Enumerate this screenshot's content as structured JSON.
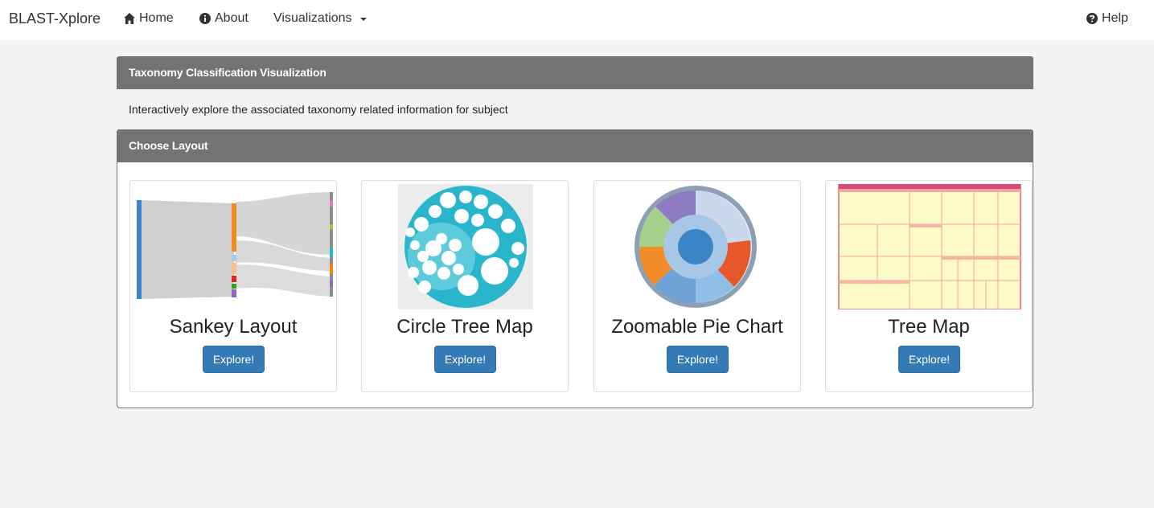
{
  "nav": {
    "brand": "BLAST-Xplore",
    "home": "Home",
    "about": "About",
    "visualizations": "Visualizations",
    "help": "Help"
  },
  "panel1": {
    "title": "Taxonomy Classification Visualization",
    "description": "Interactively explore the associated taxonomy related information for subject"
  },
  "panel2": {
    "title": "Choose Layout",
    "cards": [
      {
        "title": "Sankey Layout",
        "button": "Explore!"
      },
      {
        "title": "Circle Tree Map",
        "button": "Explore!"
      },
      {
        "title": "Zoomable Pie Chart",
        "button": "Explore!"
      },
      {
        "title": "Tree Map",
        "button": "Explore!"
      }
    ]
  },
  "colors": {
    "panel_header": "#737373",
    "button": "#337ab7",
    "background": "#f4f4f4"
  }
}
